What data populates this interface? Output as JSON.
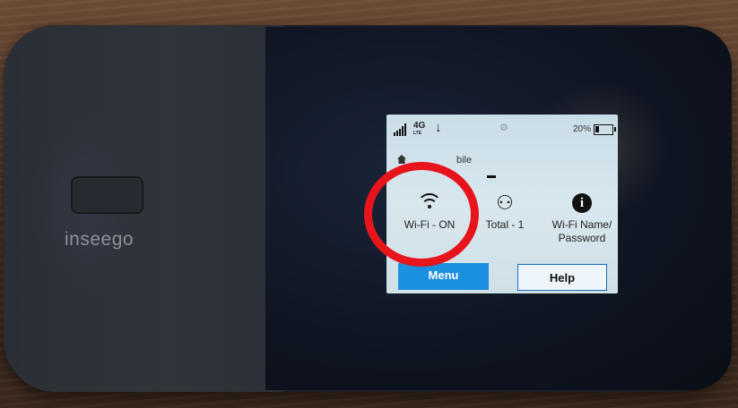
{
  "device": {
    "brand": "inseego"
  },
  "status_bar": {
    "network": "4G",
    "network_sub": "LTE",
    "download_arrow": "↓",
    "battery_text": "20%",
    "battery_level": 0.2
  },
  "screen": {
    "carrier_text": "bile"
  },
  "tiles": {
    "wifi": {
      "label": "Wi-Fi - ON",
      "icon": "wifi-icon"
    },
    "connected": {
      "label": "Total - 1",
      "icon": "users-icon"
    },
    "info": {
      "label": "Wi-Fi Name/ Password",
      "icon": "info-icon"
    }
  },
  "buttons": {
    "menu": "Menu",
    "help": "Help"
  },
  "colors": {
    "highlight": "#e8141c",
    "menu_button": "#1b8fe0"
  }
}
